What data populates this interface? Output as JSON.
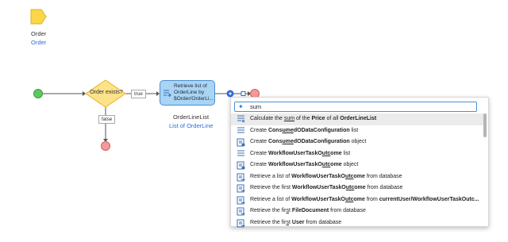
{
  "parameter": {
    "name": "Order",
    "type": "Order"
  },
  "flow": {
    "decision_label": "Order exists?",
    "true_label": "true",
    "false_label": "false",
    "activity_label": "Retrieve list of\nOrderLine by\n$Order/OrderLi...",
    "output_name": "OrderLineList",
    "output_type": "List of OrderLine"
  },
  "search": {
    "value": "sum"
  },
  "suggestions": [
    {
      "parts": [
        {
          "t": "Calculate the "
        },
        {
          "t": "sum",
          "u": true
        },
        {
          "t": " of the "
        },
        {
          "t": "Price",
          "b": true
        },
        {
          "t": " of all "
        },
        {
          "t": "OrderLineList",
          "b": true
        }
      ],
      "icon": "aggregate-icon",
      "selected": true
    },
    {
      "parts": [
        {
          "t": "Create "
        },
        {
          "t": "ConsumedODataConfiguration",
          "b": true,
          "ul": [
            4,
            7
          ]
        },
        {
          "t": " list"
        }
      ],
      "icon": "list-icon"
    },
    {
      "parts": [
        {
          "t": "Create "
        },
        {
          "t": "ConsumedODataConfiguration",
          "b": true,
          "ul": [
            4,
            7
          ]
        },
        {
          "t": " object"
        }
      ],
      "icon": "object-icon"
    },
    {
      "parts": [
        {
          "t": "Create "
        },
        {
          "t": "WorkflowUserTaskOutcome",
          "b": true,
          "ul": [
            17,
            20
          ]
        },
        {
          "t": " list"
        }
      ],
      "icon": "list-icon"
    },
    {
      "parts": [
        {
          "t": "Create "
        },
        {
          "t": "WorkflowUserTaskOutcome",
          "b": true,
          "ul": [
            17,
            20
          ]
        },
        {
          "t": " object"
        }
      ],
      "icon": "object-icon"
    },
    {
      "parts": [
        {
          "t": "Retrieve a list of "
        },
        {
          "t": "WorkflowUserTaskOutcome",
          "b": true,
          "ul": [
            17,
            20
          ]
        },
        {
          "t": " from database"
        }
      ],
      "icon": "retrieve-icon"
    },
    {
      "parts": [
        {
          "t": "Retrieve the first "
        },
        {
          "t": "WorkflowUserTaskOutcome",
          "b": true,
          "ul": [
            17,
            20
          ]
        },
        {
          "t": " from database"
        }
      ],
      "icon": "retrieve-icon"
    },
    {
      "parts": [
        {
          "t": "Retrieve a list of "
        },
        {
          "t": "WorkflowUserTaskOutcome",
          "b": true,
          "ul": [
            17,
            20
          ]
        },
        {
          "t": " from "
        },
        {
          "t": "currentUser/WorkflowUserTaskOutc...",
          "b": true
        }
      ],
      "icon": "retrieve-icon"
    },
    {
      "parts": [
        {
          "t": "Retrieve the fir"
        },
        {
          "t": "s",
          "u": true
        },
        {
          "t": "t "
        },
        {
          "t": "FileDocument",
          "b": true
        },
        {
          "t": " from database"
        }
      ],
      "icon": "retrieve-icon"
    },
    {
      "parts": [
        {
          "t": "Retrieve the fir"
        },
        {
          "t": "s",
          "u": true
        },
        {
          "t": "t "
        },
        {
          "t": "User",
          "b": true
        },
        {
          "t": " from database"
        }
      ],
      "icon": "retrieve-icon"
    }
  ],
  "colors": {
    "start": "#5cc95c",
    "end": "#f28b8b",
    "decision": "#fde28a",
    "activity": "#aad4f3",
    "accent": "#2f6bd6"
  }
}
